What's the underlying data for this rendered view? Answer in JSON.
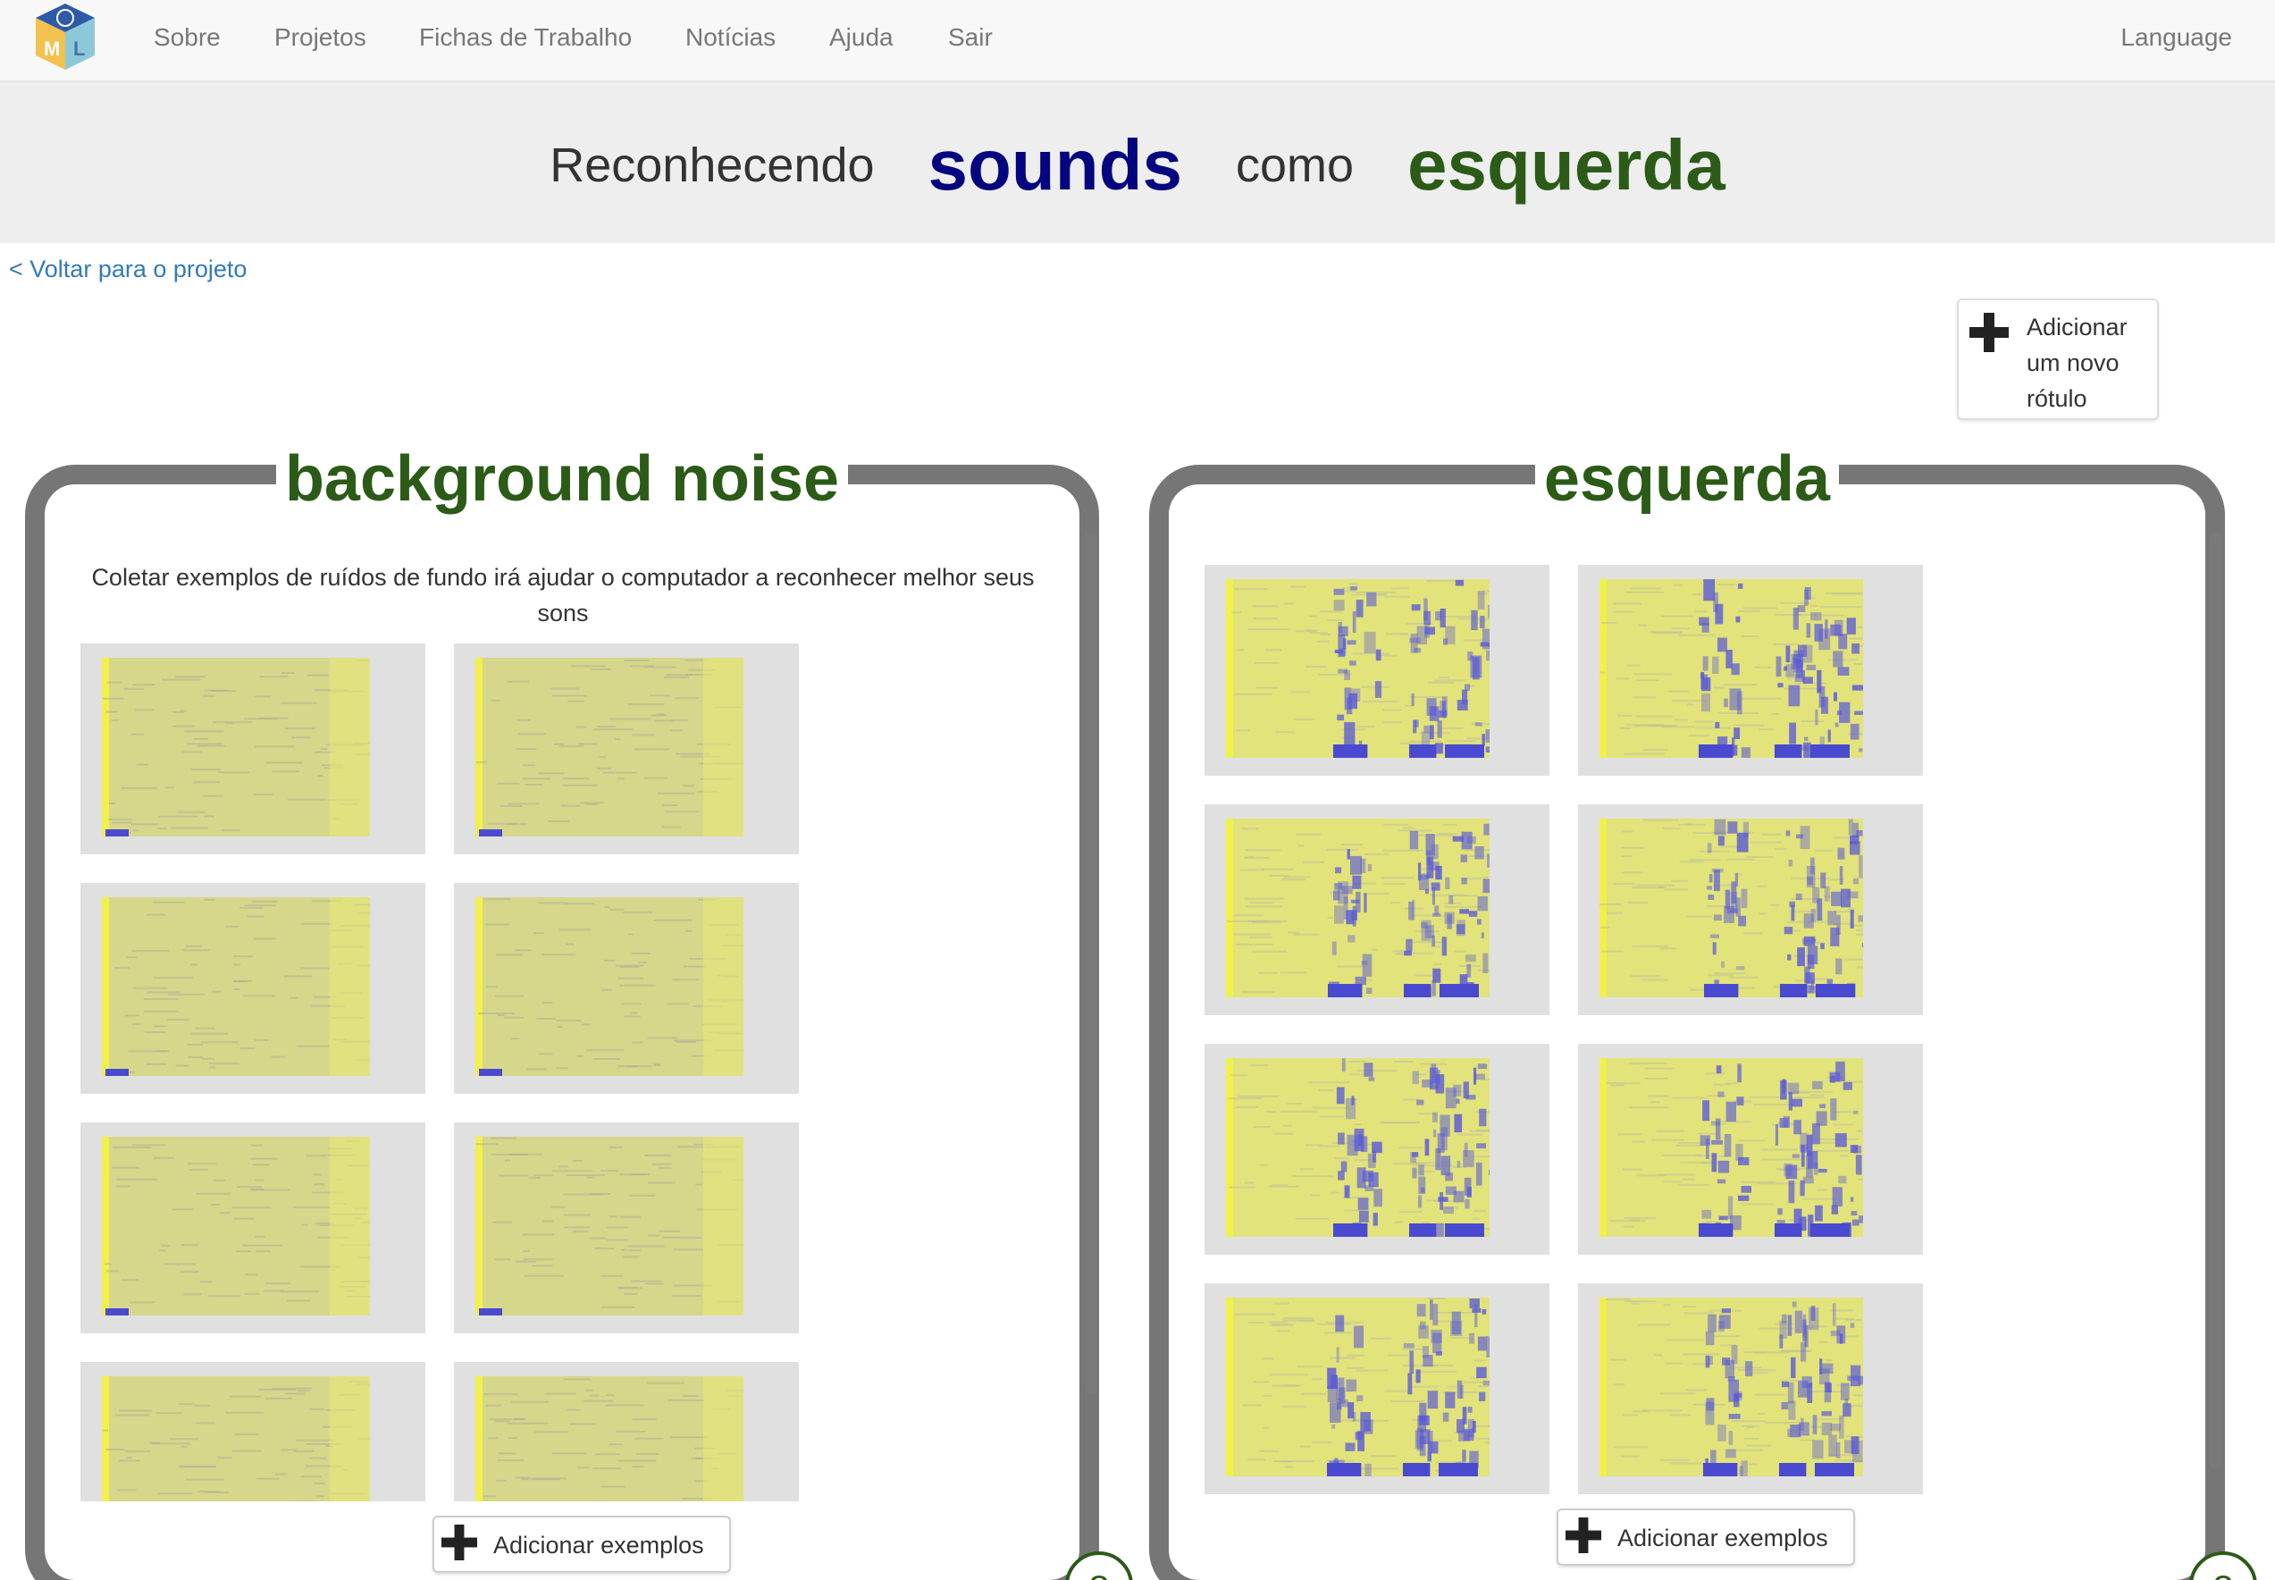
{
  "nav": {
    "items": [
      "Sobre",
      "Projetos",
      "Fichas de Trabalho",
      "Notícias",
      "Ajuda",
      "Sair"
    ],
    "language": "Language",
    "logo_letters": [
      "M",
      "L"
    ]
  },
  "banner": {
    "prefix": "Reconhecendo",
    "data_type": "sounds",
    "connector": "como",
    "label": "esquerda"
  },
  "back_link": "< Voltar para o projeto",
  "add_label_button": "Adicionar um novo rótulo",
  "panels": [
    {
      "title": "background noise",
      "hint": "Coletar exemplos de ruídos de fundo irá ajudar o computador a reconhecer melhor seus sons",
      "add_examples": "Adicionar exemplos",
      "count": "8",
      "spectrogram_kind": "noise",
      "num_examples": 8
    },
    {
      "title": "esquerda",
      "hint": "",
      "add_examples": "Adicionar exemplos",
      "count": "8",
      "spectrogram_kind": "speech",
      "num_examples": 8
    }
  ],
  "colors": {
    "title_green": "#2b5b17",
    "sounds_blue": "#050580",
    "link_blue": "#337ab7",
    "panel_border": "#767676",
    "spectrogram_yellow": "#e6e86a",
    "spectrogram_blue": "#4a4ad0"
  }
}
